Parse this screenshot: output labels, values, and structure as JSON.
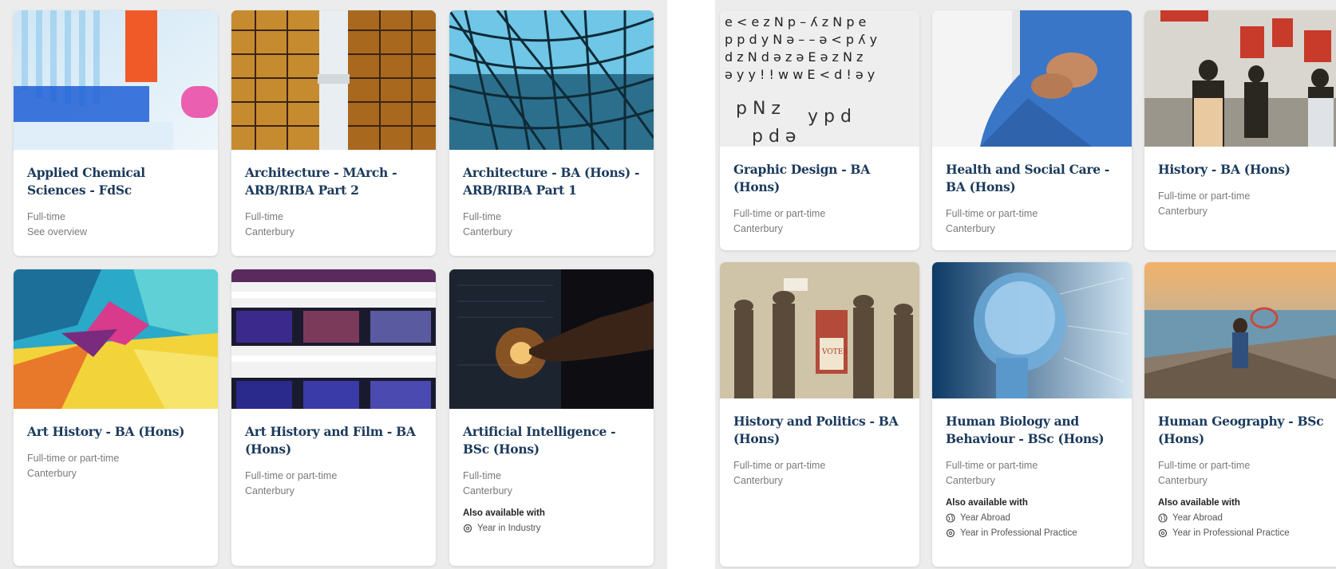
{
  "left_cards": [
    {
      "title": "Applied Chemical Sciences - FdSc",
      "meta": [
        "Full-time",
        "See overview"
      ],
      "image": "chemistry-tubes"
    },
    {
      "title": "Architecture - MArch - ARB/RIBA Part 2",
      "meta": [
        "Full-time",
        "Canterbury"
      ],
      "image": "skyscrapers"
    },
    {
      "title": "Architecture - BA (Hons) - ARB/RIBA Part 1",
      "meta": [
        "Full-time",
        "Canterbury"
      ],
      "image": "glass-roof"
    },
    {
      "title": "Art History - BA (Hons)",
      "meta": [
        "Full-time or part-time",
        "Canterbury"
      ],
      "image": "abstract-paint"
    },
    {
      "title": "Art History and Film - BA (Hons)",
      "meta": [
        "Full-time or part-time",
        "Canterbury"
      ],
      "image": "film-strip"
    },
    {
      "title": "Artificial Intelligence - BSc (Hons)",
      "meta": [
        "Full-time",
        "Canterbury"
      ],
      "image": "ai-finger",
      "also_label": "Also available with",
      "options": [
        {
          "label": "Year in Industry",
          "icon": "gear-icon"
        }
      ]
    }
  ],
  "right_cards": [
    {
      "title": "Graphic Design - BA (Hons)",
      "meta": [
        "Full-time or part-time",
        "Canterbury"
      ],
      "image": "typography"
    },
    {
      "title": "Health and Social Care - BA (Hons)",
      "meta": [
        "Full-time or part-time",
        "Canterbury"
      ],
      "image": "holding-hands"
    },
    {
      "title": "History - BA (Hons)",
      "meta": [
        "Full-time or part-time",
        "Canterbury"
      ],
      "image": "protest-march"
    },
    {
      "title": "History and Politics - BA (Hons)",
      "meta": [
        "Full-time or part-time",
        "Canterbury"
      ],
      "image": "suffragettes"
    },
    {
      "title": "Human Biology and Behaviour - BSc (Hons)",
      "meta": [
        "Full-time or part-time",
        "Canterbury"
      ],
      "image": "xray-head",
      "also_label": "Also available with",
      "options": [
        {
          "label": "Year Abroad",
          "icon": "globe-icon"
        },
        {
          "label": "Year in Professional Practice",
          "icon": "gear-icon"
        }
      ]
    },
    {
      "title": "Human Geography - BSc (Hons)",
      "meta": [
        "Full-time or part-time",
        "Canterbury"
      ],
      "image": "coastal-view",
      "also_label": "Also available with",
      "options": [
        {
          "label": "Year Abroad",
          "icon": "globe-icon"
        },
        {
          "label": "Year in Professional Practice",
          "icon": "gear-icon"
        }
      ]
    }
  ],
  "colors": {
    "title": "#1b3a5c",
    "meta": "#7a7a7a",
    "panel": "#ececec"
  }
}
